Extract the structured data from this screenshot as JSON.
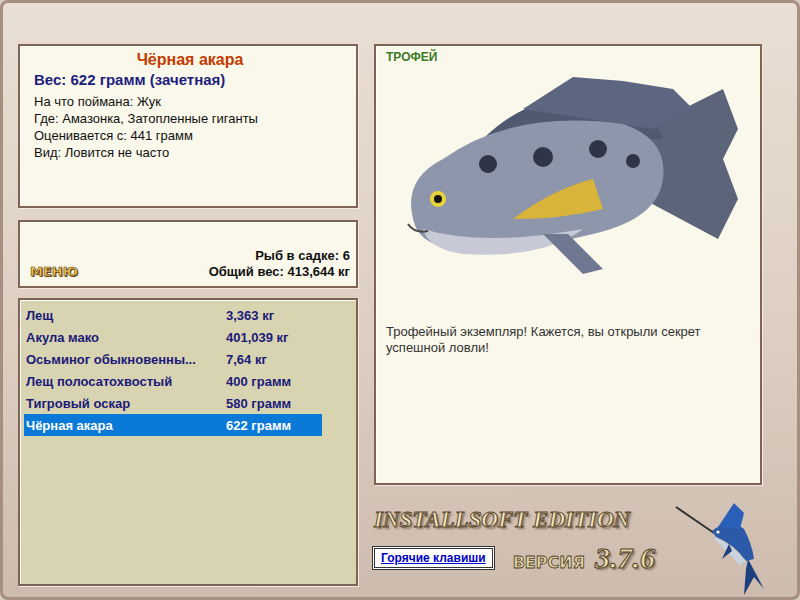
{
  "info": {
    "title": "Чёрная акара",
    "weight": "Вес: 622 грамм (зачетная)",
    "details": [
      "На что поймана: Жук",
      "Где: Амазонка, Затопленные гиганты",
      "Оценивается с: 441 грамм",
      "Вид: Ловится не часто"
    ]
  },
  "menu_button": "МЕНЮ",
  "keepnet": {
    "count": "Рыб в садке: 6",
    "total": "Общий вес: 413,644 кг"
  },
  "catch_list": [
    {
      "name": "Лещ",
      "weight": "3,363 кг",
      "selected": false
    },
    {
      "name": "Акула мако",
      "weight": "401,039 кг",
      "selected": false
    },
    {
      "name": "Осьминог обыкновенны...",
      "weight": "7,64 кг",
      "selected": false
    },
    {
      "name": "Лещ полосатохвостый",
      "weight": "400 грамм",
      "selected": false
    },
    {
      "name": "Тигровый оскар",
      "weight": "580 грамм",
      "selected": false
    },
    {
      "name": "Чёрная акара",
      "weight": "622 грамм",
      "selected": true
    }
  ],
  "trophy": {
    "badge": "ТРОФЕЙ",
    "message": "Трофейный экземпляр! Кажется, вы открыли секрет успешной ловли!"
  },
  "edition": "INSTALLSOFT EDITION",
  "version_label": "ВЕРСИЯ",
  "version": "3.7.6",
  "hotkeys_button": "Горячие клавиши"
}
